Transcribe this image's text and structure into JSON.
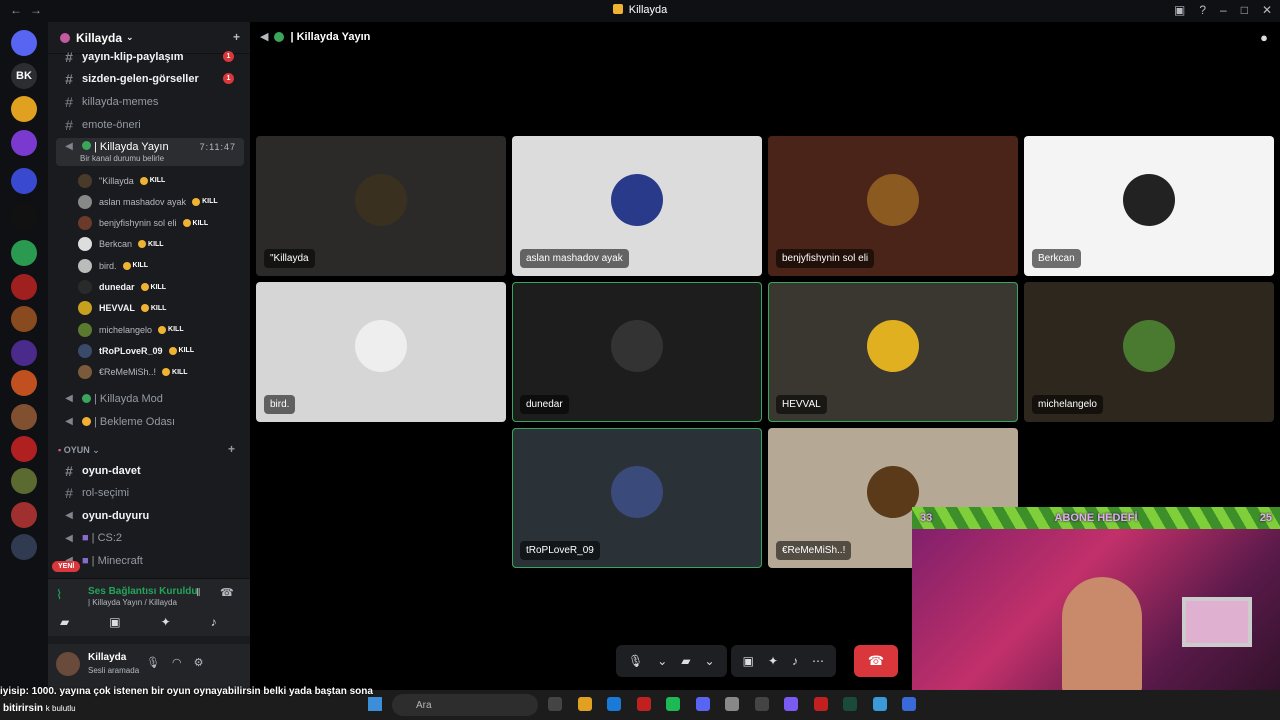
{
  "window": {
    "title": "Killayda",
    "back": "←",
    "forward": "→"
  },
  "guilds": [
    {
      "label": "",
      "badge": "9",
      "color": "#5865f2"
    },
    {
      "label": "BK",
      "badge": "",
      "color": "#2b2d31"
    },
    {
      "label": "",
      "badge": "8",
      "color": "#e0a020"
    },
    {
      "label": "",
      "badge": "45",
      "color": "#7a3ad0"
    },
    {
      "label": "",
      "badge": "",
      "color": "#3a4ad0"
    },
    {
      "label": "",
      "badge": "206",
      "color": "#111"
    },
    {
      "label": "",
      "badge": "139",
      "color": "#2a9a50"
    },
    {
      "label": "",
      "badge": "67",
      "color": "#a02020"
    },
    {
      "label": "",
      "badge": "86",
      "color": "#8a4a20"
    },
    {
      "label": "",
      "badge": "83",
      "color": "#4a2a8a"
    },
    {
      "label": "",
      "badge": "325",
      "color": "#c05020"
    },
    {
      "label": "",
      "badge": "134",
      "color": "#805030"
    },
    {
      "label": "",
      "badge": "",
      "color": "#b02020"
    },
    {
      "label": "",
      "badge": "28",
      "color": "#5a6a30"
    },
    {
      "label": "",
      "badge": "155",
      "color": "#a03030"
    },
    {
      "label": "",
      "badge": "120",
      "color": "#303a50"
    }
  ],
  "new_label": "YENİ",
  "server": {
    "name": "Killayda",
    "add_icon": "+"
  },
  "channels": [
    {
      "name": "yayın-klip-paylaşım",
      "bold": true,
      "unread": "1"
    },
    {
      "name": "sizden-gelen-görseller",
      "bold": true,
      "unread": "1"
    },
    {
      "name": "killayda-memes",
      "bold": false,
      "unread": ""
    },
    {
      "name": "emote-öneri",
      "bold": false,
      "unread": ""
    }
  ],
  "active_channel": {
    "name": "| Killayda Yayın",
    "time": "7:11:47",
    "status": "Bir kanal durumu belirle"
  },
  "voice_users": [
    {
      "name": "\"Killayda",
      "bold": false,
      "kill": true
    },
    {
      "name": "aslan mashadov ayak",
      "bold": false,
      "kill": true
    },
    {
      "name": "benjyfishynin sol eli",
      "bold": false,
      "kill": true
    },
    {
      "name": "Berkcan",
      "bold": false,
      "kill": true
    },
    {
      "name": "bird.",
      "bold": false,
      "kill": true
    },
    {
      "name": "dunedar",
      "bold": true,
      "kill": true
    },
    {
      "name": "HEVVAL",
      "bold": true,
      "kill": true
    },
    {
      "name": "michelangelo",
      "bold": false,
      "kill": true
    },
    {
      "name": "tRoPLoveR_09",
      "bold": true,
      "kill": true
    },
    {
      "name": "€ReMeMiSh..!",
      "bold": false,
      "kill": true
    }
  ],
  "kill_label": "KILL",
  "more_channels": [
    {
      "name": "| Killayda Mod",
      "icon": "speaker"
    },
    {
      "name": "| Bekleme Odası",
      "icon": "speaker"
    }
  ],
  "category": {
    "name": "OYUN",
    "plus": "+"
  },
  "game_channels": [
    {
      "name": "oyun-davet",
      "bold": true,
      "type": "text"
    },
    {
      "name": "rol-seçimi",
      "bold": false,
      "type": "text"
    },
    {
      "name": "oyun-duyuru",
      "bold": true,
      "type": "announce"
    },
    {
      "name": "| CS:2",
      "bold": false,
      "type": "voice"
    },
    {
      "name": "| Minecraft",
      "bold": false,
      "type": "voice"
    }
  ],
  "voice_status": {
    "title": "Ses Bağlantısı Kuruldu",
    "subtitle": "| Killayda Yayın / Killayda"
  },
  "me": {
    "name": "Killayda",
    "status": "Sesli aramada"
  },
  "call_header": {
    "title": "| Killayda Yayın"
  },
  "tiles": [
    {
      "name": "\"Killayda",
      "bg": "#2b2a28",
      "avatar": "#3a3020",
      "speaking": false
    },
    {
      "name": "aslan mashadov ayak",
      "bg": "#dcdcdc",
      "avatar": "#2a3a8a",
      "speaking": false
    },
    {
      "name": "benjyfishynin sol eli",
      "bg": "#4a2418",
      "avatar": "#8a5a20",
      "speaking": false
    },
    {
      "name": "Berkcan",
      "bg": "#f4f4f4",
      "avatar": "#222",
      "speaking": false
    },
    {
      "name": "bird.",
      "bg": "#d6d6d6",
      "avatar": "#eee",
      "speaking": false
    },
    {
      "name": "dunedar",
      "bg": "#1d1d1d",
      "avatar": "#333",
      "speaking": true
    },
    {
      "name": "HEVVAL",
      "bg": "#3a3630",
      "avatar": "#e0b020",
      "speaking": true
    },
    {
      "name": "michelangelo",
      "bg": "#2e271e",
      "avatar": "#4a7a30",
      "speaking": false
    },
    {
      "name": "tRoPLoveR_09",
      "bg": "#2a3238",
      "avatar": "#3a4a7a",
      "speaking": true
    },
    {
      "name": "€ReMeMiSh..!",
      "bg": "#b5a995",
      "avatar": "#5a3a18",
      "speaking": false
    }
  ],
  "overlay": {
    "left": "33",
    "title": "ABONE HEDEFİ",
    "right": "25"
  },
  "ticker": {
    "line1": "iyisip: 1000. yayına çok istenen bir oyun oynayabilirsin belki yada baştan sona",
    "line2": "bitirirsin",
    "line3": "k bulutlu"
  },
  "taskbar": {
    "search_placeholder": "Ara"
  }
}
